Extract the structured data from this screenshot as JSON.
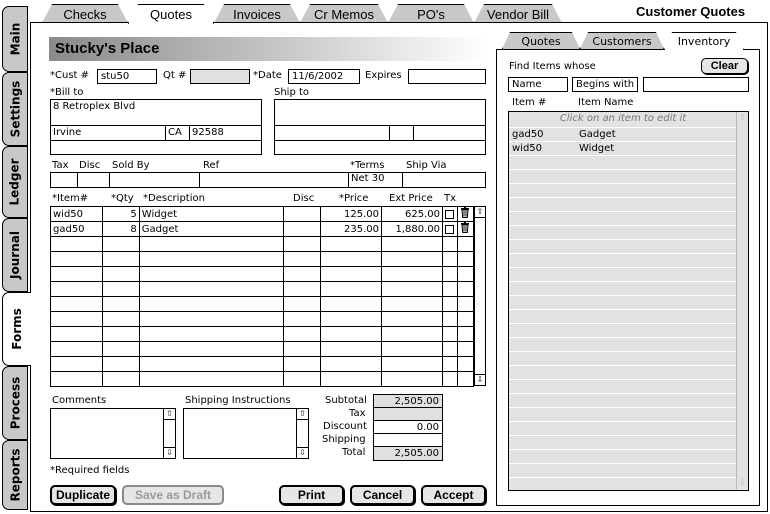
{
  "window_title": "Customer Quotes",
  "top_tabs": [
    "Checks",
    "Quotes",
    "Invoices",
    "Cr Memos",
    "PO's",
    "Vendor Bill"
  ],
  "side_tabs": [
    "Main",
    "Settings",
    "Ledger",
    "Journal",
    "Forms",
    "Process",
    "Reports"
  ],
  "customer_name": "Stucky's Place",
  "labels": {
    "cust": "*Cust #",
    "qt": "Qt #",
    "date": "*Date",
    "expires": "Expires",
    "bill_to": "*Bill to",
    "ship_to": "Ship to",
    "tax": "Tax",
    "disc": "Disc",
    "sold_by": "Sold By",
    "ref": "Ref",
    "terms": "*Terms",
    "ship_via": "Ship Via",
    "comments": "Comments",
    "shipping_instructions": "Shipping Instructions",
    "required": "*Required fields"
  },
  "fields": {
    "cust": "stu50",
    "qt": "",
    "date": "11/6/2002",
    "expires": "",
    "bill_address": "8 Retroplex Blvd",
    "bill_city": "Irvine",
    "bill_state": "CA",
    "bill_zip": "92588",
    "terms": "Net 30"
  },
  "line_items": {
    "headers": [
      "*Item#",
      "*Qty",
      "*Description",
      "Disc",
      "*Price",
      "Ext Price",
      "Tx"
    ],
    "rows": [
      {
        "item": "wid50",
        "qty": "5",
        "desc": "Widget",
        "disc": "",
        "price": "125.00",
        "ext": "625.00"
      },
      {
        "item": "gad50",
        "qty": "8",
        "desc": "Gadget",
        "disc": "",
        "price": "235.00",
        "ext": "1,880.00"
      }
    ]
  },
  "totals": {
    "subtotal_label": "Subtotal",
    "subtotal": "2,505.00",
    "tax_label": "Tax",
    "tax": "",
    "discount_label": "Discount",
    "discount": "0.00",
    "shipping_label": "Shipping",
    "shipping": "",
    "total_label": "Total",
    "total": "2,505.00"
  },
  "buttons": {
    "duplicate": "Duplicate",
    "save_draft": "Save as Draft",
    "print": "Print",
    "cancel": "Cancel",
    "accept": "Accept",
    "clear": "Clear"
  },
  "right_panel": {
    "tabs": [
      "Quotes",
      "Customers",
      "Inventory"
    ],
    "find_label": "Find Items whose",
    "field_select": "Name",
    "op_select": "Begins with",
    "search_value": "",
    "col_item": "Item #",
    "col_name": "Item Name",
    "hint": "Click on an item to edit it",
    "items": [
      {
        "item": "gad50",
        "name": "Gadget"
      },
      {
        "item": "wid50",
        "name": "Widget"
      }
    ]
  }
}
